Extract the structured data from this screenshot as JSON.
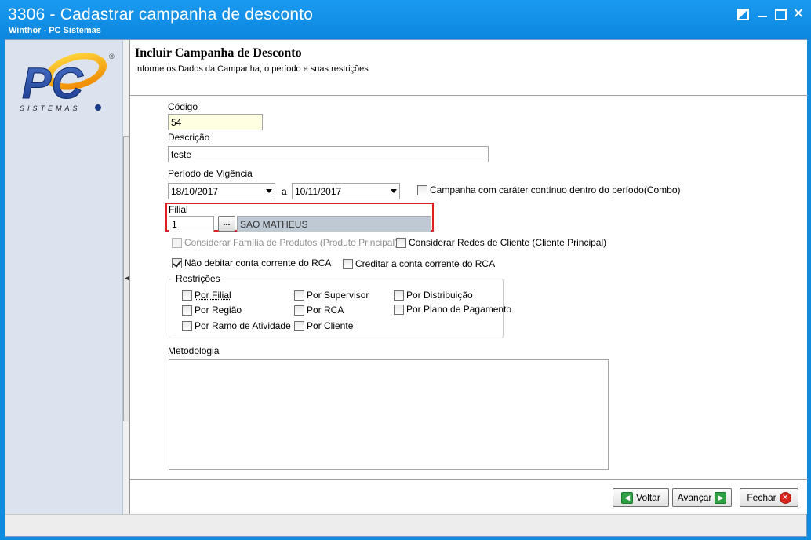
{
  "window": {
    "title": "3306 - Cadastrar campanha de desconto",
    "subtitle": "Winthor - PC Sistemas"
  },
  "logo": {
    "main_text": "PC",
    "sub_text": "SISTEMAS",
    "registered": "®"
  },
  "header": {
    "title": "Incluir Campanha de Desconto",
    "subtitle": "Informe os Dados da Campanha, o período e suas restrições"
  },
  "form": {
    "codigo": {
      "label": "Código",
      "value": "54"
    },
    "descricao": {
      "label": "Descrição",
      "value": "teste"
    },
    "periodo": {
      "label": "Período de Vigência",
      "start": "18/10/2017",
      "separator": "a",
      "end": "10/11/2017"
    },
    "combo_checkbox": {
      "label": "Campanha com caráter contínuo dentro do período(Combo)",
      "checked": false
    },
    "filial": {
      "label": "Filial",
      "code": "1",
      "lookup_label": "...",
      "name": "SAO MATHEUS"
    },
    "familia_produtos": {
      "label": "Considerar Família de Produtos (Produto Principal)",
      "checked": false
    },
    "redes_cliente": {
      "label": "Considerar Redes de Cliente (Cliente Principal)",
      "checked": false
    },
    "nao_debitar": {
      "label": "Não debitar conta corrente do RCA",
      "checked": true
    },
    "creditar": {
      "label": "Creditar a conta corrente do RCA",
      "checked": false
    },
    "restricoes": {
      "title": "Restrições",
      "items": [
        {
          "label": "Por Filial",
          "checked": false
        },
        {
          "label": "Por Região",
          "checked": false
        },
        {
          "label": "Por Ramo de Atividade",
          "checked": false
        },
        {
          "label": "Por Supervisor",
          "checked": false
        },
        {
          "label": "Por RCA",
          "checked": false
        },
        {
          "label": "Por Cliente",
          "checked": false
        },
        {
          "label": "Por Distribuição",
          "checked": false
        },
        {
          "label": "Por Plano de Pagamento",
          "checked": false
        }
      ]
    },
    "metodologia": {
      "label": "Metodologia",
      "value": ""
    }
  },
  "buttons": {
    "voltar": "Voltar",
    "avancar": "Avançar",
    "fechar": "Fechar"
  },
  "colors": {
    "titlebar": "#0f8be0",
    "highlight_frame": "#e02020",
    "codigo_bg": "#ffffe1"
  }
}
